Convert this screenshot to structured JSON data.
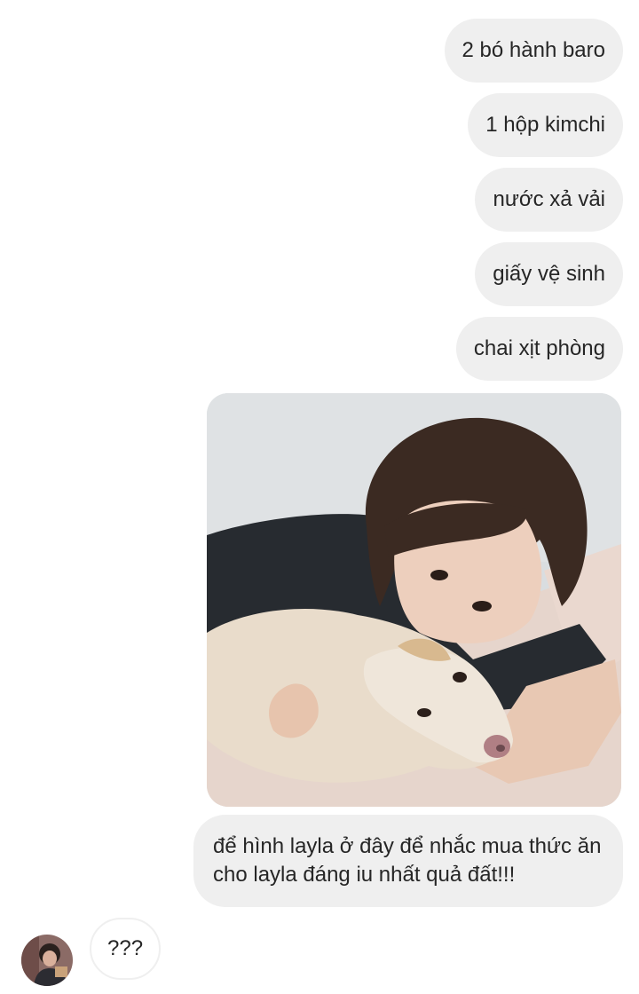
{
  "messages_out": [
    {
      "text": "2 bó hành baro"
    },
    {
      "text": "1 hộp kimchi"
    },
    {
      "text": "nước xả vải"
    },
    {
      "text": "giấy vệ sinh"
    },
    {
      "text": "chai xịt phòng"
    }
  ],
  "photo": {
    "kind": "photo-message"
  },
  "caption": {
    "line1": "để hình layla ở đây để nhắc mua thức ăn",
    "line2": "cho layla đáng iu nhất quả đất!!!"
  },
  "reply": {
    "text": "???"
  },
  "colors": {
    "bubble_bg": "#efefef",
    "text": "#262626",
    "background": "#ffffff"
  }
}
